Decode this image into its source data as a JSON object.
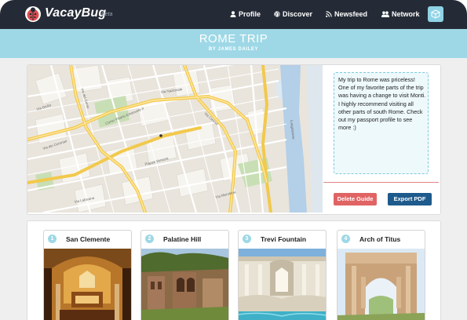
{
  "nav": {
    "brand": "VacayBug",
    "beta": "Beta",
    "links": [
      {
        "label": "Profile",
        "icon": "user-icon"
      },
      {
        "label": "Discover",
        "icon": "globe-icon"
      },
      {
        "label": "Newsfeed",
        "icon": "rss-icon"
      },
      {
        "label": "Network",
        "icon": "users-icon"
      }
    ],
    "menu_icon": "cube-icon"
  },
  "trip": {
    "title": "ROME TRIP",
    "author": "BY JAMES DAILEY"
  },
  "map": {
    "labels": [
      "Via Giulia",
      "Via Nazionale",
      "Via dei Coronari",
      "Corso Vittorio Emanuele II",
      "Via del Corso",
      "Via Cavour",
      "Lungotevere",
      "Piazza Venezia",
      "Via Merulana",
      "Via Labicana"
    ]
  },
  "guide": {
    "note": "My trip to Rome was priceless! One of my favorite parts of the trip was having a change to visit Monti. I highly recommend visiting all other parts of south Rome. Check out my passport profile to see more :)",
    "delete_label": "Delete Guide",
    "export_label": "Export PDF"
  },
  "sites": [
    {
      "number": "1",
      "name": "San Clemente"
    },
    {
      "number": "2",
      "name": "Palatine Hill"
    },
    {
      "number": "3",
      "name": "Trevi Fountain"
    },
    {
      "number": "4",
      "name": "Arch of Titus"
    }
  ],
  "colors": {
    "nav_bg": "#252b36",
    "banner_bg": "#9ed8e6",
    "delete_button": "#e16464",
    "export_button": "#1e5a8c",
    "note_border": "#7ec9dc"
  }
}
